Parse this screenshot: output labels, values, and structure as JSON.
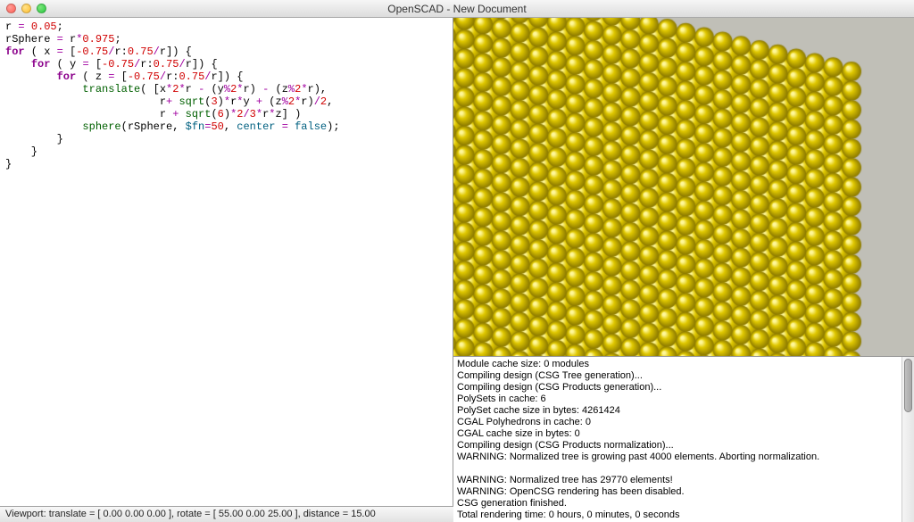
{
  "window": {
    "title": "OpenSCAD - New Document"
  },
  "editor": {
    "lines": [
      [
        [
          "r ",
          ""
        ],
        [
          "=",
          "op"
        ],
        [
          " ",
          ""
        ],
        [
          "0.05",
          "num"
        ],
        [
          ";",
          ""
        ]
      ],
      [
        [
          "rSphere ",
          ""
        ],
        [
          "=",
          "op"
        ],
        [
          " r",
          ""
        ],
        [
          "*",
          "op"
        ],
        [
          "0.975",
          "num"
        ],
        [
          ";",
          ""
        ]
      ],
      [
        [
          "for",
          "kw"
        ],
        [
          " ( x ",
          ""
        ],
        [
          "=",
          "op"
        ],
        [
          " [",
          ""
        ],
        [
          "-0.75",
          "num"
        ],
        [
          "/",
          "op"
        ],
        [
          "r",
          ""
        ],
        [
          ":",
          ""
        ],
        [
          "0.75",
          "num"
        ],
        [
          "/",
          "op"
        ],
        [
          "r]) {",
          ""
        ]
      ],
      [
        [
          "    ",
          ""
        ],
        [
          "for",
          "kw"
        ],
        [
          " ( y ",
          ""
        ],
        [
          "=",
          "op"
        ],
        [
          " [",
          ""
        ],
        [
          "-0.75",
          "num"
        ],
        [
          "/",
          "op"
        ],
        [
          "r",
          ""
        ],
        [
          ":",
          ""
        ],
        [
          "0.75",
          "num"
        ],
        [
          "/",
          "op"
        ],
        [
          "r]) {",
          ""
        ]
      ],
      [
        [
          "        ",
          ""
        ],
        [
          "for",
          "kw"
        ],
        [
          " ( z ",
          ""
        ],
        [
          "=",
          "op"
        ],
        [
          " [",
          ""
        ],
        [
          "-0.75",
          "num"
        ],
        [
          "/",
          "op"
        ],
        [
          "r",
          ""
        ],
        [
          ":",
          ""
        ],
        [
          "0.75",
          "num"
        ],
        [
          "/",
          "op"
        ],
        [
          "r]) {",
          ""
        ]
      ],
      [
        [
          "            ",
          ""
        ],
        [
          "translate",
          "func"
        ],
        [
          "( [x",
          ""
        ],
        [
          "*",
          "op"
        ],
        [
          "2",
          "num"
        ],
        [
          "*",
          "op"
        ],
        [
          "r ",
          ""
        ],
        [
          "-",
          "op"
        ],
        [
          " (y",
          ""
        ],
        [
          "%",
          "op"
        ],
        [
          "2",
          "num"
        ],
        [
          "*",
          "op"
        ],
        [
          "r) ",
          ""
        ],
        [
          "-",
          "op"
        ],
        [
          " (z",
          ""
        ],
        [
          "%",
          "op"
        ],
        [
          "2",
          "num"
        ],
        [
          "*",
          "op"
        ],
        [
          "r),",
          ""
        ]
      ],
      [
        [
          "                        r",
          ""
        ],
        [
          "+",
          "op"
        ],
        [
          " ",
          ""
        ],
        [
          "sqrt",
          "func"
        ],
        [
          "(",
          ""
        ],
        [
          "3",
          "num"
        ],
        [
          ")",
          ""
        ],
        [
          "*",
          "op"
        ],
        [
          "r",
          ""
        ],
        [
          "*",
          "op"
        ],
        [
          "y ",
          ""
        ],
        [
          "+",
          "op"
        ],
        [
          " (z",
          ""
        ],
        [
          "%",
          "op"
        ],
        [
          "2",
          "num"
        ],
        [
          "*",
          "op"
        ],
        [
          "r)",
          ""
        ],
        [
          "/",
          "op"
        ],
        [
          "2",
          "num"
        ],
        [
          ",",
          ""
        ]
      ],
      [
        [
          "                        r ",
          ""
        ],
        [
          "+",
          "op"
        ],
        [
          " ",
          ""
        ],
        [
          "sqrt",
          "func"
        ],
        [
          "(",
          ""
        ],
        [
          "6",
          "num"
        ],
        [
          ")",
          ""
        ],
        [
          "*",
          "op"
        ],
        [
          "2",
          "num"
        ],
        [
          "/",
          "op"
        ],
        [
          "3",
          "num"
        ],
        [
          "*",
          "op"
        ],
        [
          "r",
          ""
        ],
        [
          "*",
          "op"
        ],
        [
          "z] )",
          ""
        ]
      ],
      [
        [
          "            ",
          ""
        ],
        [
          "sphere",
          "func"
        ],
        [
          "(rSphere, ",
          ""
        ],
        [
          "$fn",
          "arg"
        ],
        [
          "=",
          "op"
        ],
        [
          "50",
          "num"
        ],
        [
          ", ",
          ""
        ],
        [
          "center",
          "arg"
        ],
        [
          " ",
          ""
        ],
        [
          "=",
          "op"
        ],
        [
          " ",
          ""
        ],
        [
          "false",
          "bool"
        ],
        [
          ");",
          ""
        ]
      ],
      [
        [
          "        }",
          ""
        ]
      ],
      [
        [
          "    }",
          ""
        ]
      ],
      [
        [
          "}",
          ""
        ]
      ]
    ]
  },
  "console": {
    "lines": [
      "Module cache size: 0 modules",
      "Compiling design (CSG Tree generation)...",
      "Compiling design (CSG Products generation)...",
      "PolySets in cache: 6",
      "PolySet cache size in bytes: 4261424",
      "CGAL Polyhedrons in cache: 0",
      "CGAL cache size in bytes: 0",
      "Compiling design (CSG Products normalization)...",
      "WARNING: Normalized tree is growing past 4000 elements. Aborting normalization.",
      "",
      "WARNING: Normalized tree has 29770 elements!",
      "WARNING: OpenCSG rendering has been disabled.",
      "CSG generation finished.",
      "Total rendering time: 0 hours, 0 minutes, 0 seconds"
    ]
  },
  "statusbar": {
    "text": "Viewport: translate = [ 0.00 0.00 0.00 ], rotate = [ 55.00 0.00 25.00 ], distance = 15.00"
  },
  "render3d": {
    "description": "3D viewport showing a large cube made of many small yellow spheres in a close-packed lattice",
    "sphere_color": "#e0c800",
    "highlight_color": "#fff799",
    "shadow_color": "#8a7800",
    "background": "#c0bfb7"
  }
}
